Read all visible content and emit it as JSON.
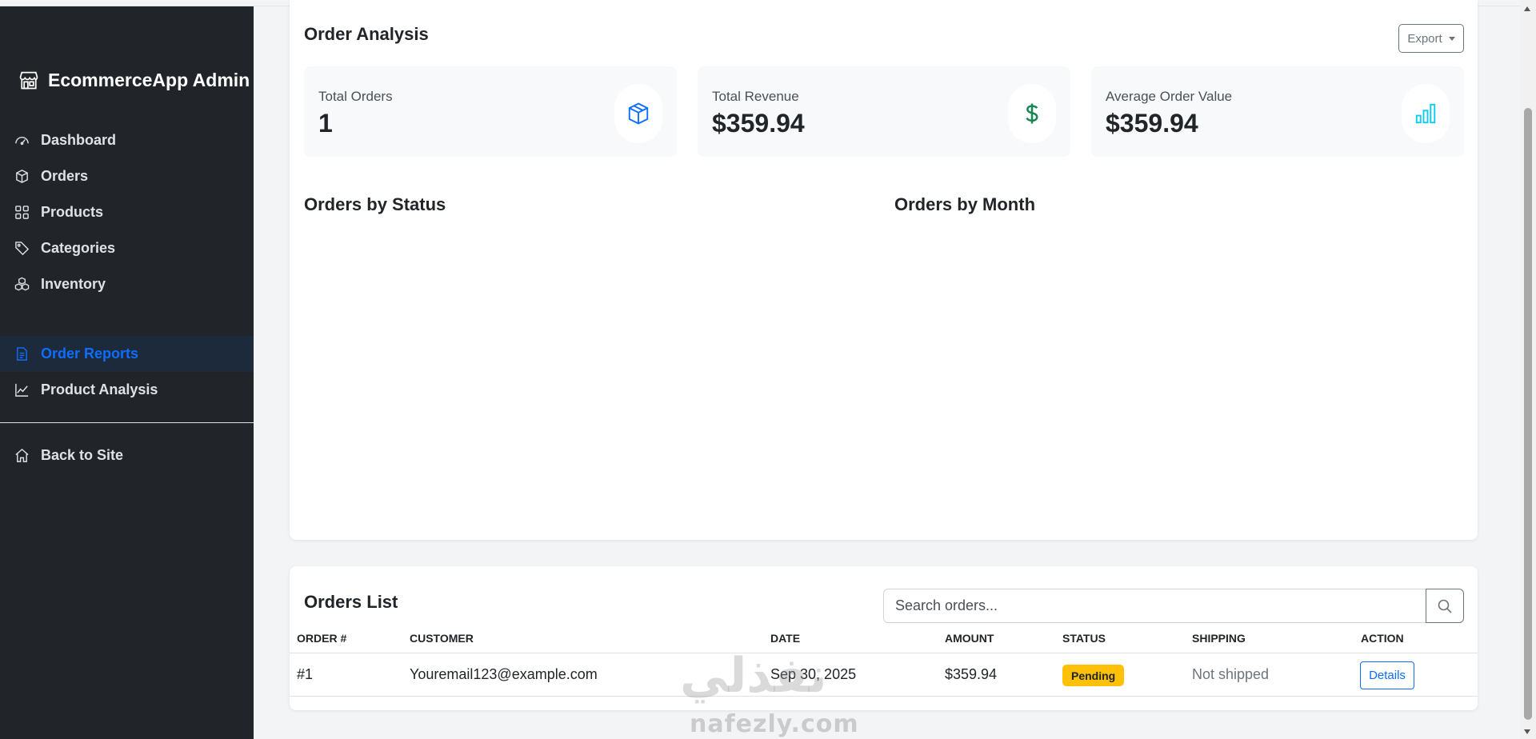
{
  "app": {
    "brand": "EcommerceApp Admin"
  },
  "sidebar": {
    "items": [
      {
        "label": "Dashboard",
        "icon": "speedometer-icon"
      },
      {
        "label": "Orders",
        "icon": "box-icon"
      },
      {
        "label": "Products",
        "icon": "grid-icon"
      },
      {
        "label": "Categories",
        "icon": "tags-icon"
      },
      {
        "label": "Inventory",
        "icon": "boxes-icon"
      },
      {
        "label": "Order Reports",
        "icon": "file-text-icon",
        "active": true
      },
      {
        "label": "Product Analysis",
        "icon": "graph-up-icon"
      },
      {
        "label": "Back to Site",
        "icon": "house-icon"
      }
    ]
  },
  "analysis": {
    "title": "Order Analysis",
    "export_label": "Export",
    "stats": [
      {
        "label": "Total Orders",
        "value": "1",
        "icon": "box-icon"
      },
      {
        "label": "Total Revenue",
        "value": "$359.94",
        "icon": "dollar-icon"
      },
      {
        "label": "Average Order Value",
        "value": "$359.94",
        "icon": "bar-chart-icon"
      }
    ],
    "status_chart_title": "Orders by Status",
    "month_chart_title": "Orders by Month"
  },
  "orders_list": {
    "title": "Orders List",
    "search_placeholder": "Search orders...",
    "columns": [
      "ORDER #",
      "CUSTOMER",
      "DATE",
      "AMOUNT",
      "STATUS",
      "SHIPPING",
      "ACTION"
    ],
    "rows": [
      {
        "order": "#1",
        "customer": "Youremail123@example.com",
        "date": "Sep 30, 2025",
        "amount": "$359.94",
        "status": "Pending",
        "shipping": "Not shipped",
        "action": "Details"
      }
    ]
  },
  "watermark": {
    "logo": "نفذلي",
    "text": "nafezly.com"
  },
  "colors": {
    "sidebar_bg": "#212529",
    "accent": "#0d6efd",
    "pending": "#ffc107",
    "revenue_icon": "#198754",
    "value_icon": "#0dcaf0"
  }
}
